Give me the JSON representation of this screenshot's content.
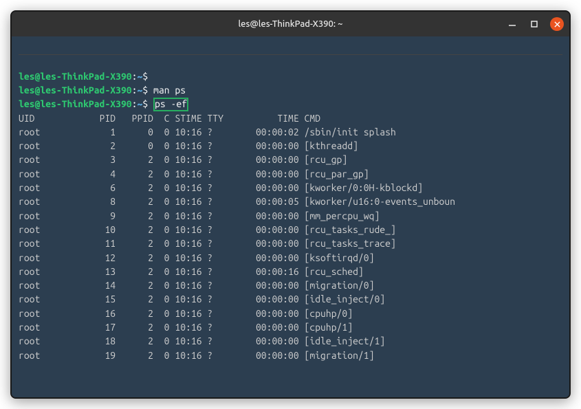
{
  "window": {
    "title": "les@les-ThinkPad-X390: ~"
  },
  "prompt": {
    "user_host": "les@les-ThinkPad-X390",
    "sep": ":",
    "path": "~",
    "dollar": "$"
  },
  "commands": {
    "empty": "",
    "manps": "man ps",
    "psef": "ps -ef"
  },
  "ps": {
    "header": {
      "uid": "UID",
      "pid": "PID",
      "ppid": "PPID",
      "c": "C",
      "stime": "STIME",
      "tty": "TTY",
      "time": "TIME",
      "cmd": "CMD"
    },
    "rows": [
      {
        "uid": "root",
        "pid": "1",
        "ppid": "0",
        "c": "0",
        "stime": "10:16",
        "tty": "?",
        "time": "00:00:02",
        "cmd": "/sbin/init splash"
      },
      {
        "uid": "root",
        "pid": "2",
        "ppid": "0",
        "c": "0",
        "stime": "10:16",
        "tty": "?",
        "time": "00:00:00",
        "cmd": "[kthreadd]"
      },
      {
        "uid": "root",
        "pid": "3",
        "ppid": "2",
        "c": "0",
        "stime": "10:16",
        "tty": "?",
        "time": "00:00:00",
        "cmd": "[rcu_gp]"
      },
      {
        "uid": "root",
        "pid": "4",
        "ppid": "2",
        "c": "0",
        "stime": "10:16",
        "tty": "?",
        "time": "00:00:00",
        "cmd": "[rcu_par_gp]"
      },
      {
        "uid": "root",
        "pid": "6",
        "ppid": "2",
        "c": "0",
        "stime": "10:16",
        "tty": "?",
        "time": "00:00:00",
        "cmd": "[kworker/0:0H-kblockd]"
      },
      {
        "uid": "root",
        "pid": "8",
        "ppid": "2",
        "c": "0",
        "stime": "10:16",
        "tty": "?",
        "time": "00:00:05",
        "cmd": "[kworker/u16:0-events_unboun"
      },
      {
        "uid": "root",
        "pid": "9",
        "ppid": "2",
        "c": "0",
        "stime": "10:16",
        "tty": "?",
        "time": "00:00:00",
        "cmd": "[mm_percpu_wq]"
      },
      {
        "uid": "root",
        "pid": "10",
        "ppid": "2",
        "c": "0",
        "stime": "10:16",
        "tty": "?",
        "time": "00:00:00",
        "cmd": "[rcu_tasks_rude_]"
      },
      {
        "uid": "root",
        "pid": "11",
        "ppid": "2",
        "c": "0",
        "stime": "10:16",
        "tty": "?",
        "time": "00:00:00",
        "cmd": "[rcu_tasks_trace]"
      },
      {
        "uid": "root",
        "pid": "12",
        "ppid": "2",
        "c": "0",
        "stime": "10:16",
        "tty": "?",
        "time": "00:00:00",
        "cmd": "[ksoftirqd/0]"
      },
      {
        "uid": "root",
        "pid": "13",
        "ppid": "2",
        "c": "0",
        "stime": "10:16",
        "tty": "?",
        "time": "00:00:16",
        "cmd": "[rcu_sched]"
      },
      {
        "uid": "root",
        "pid": "14",
        "ppid": "2",
        "c": "0",
        "stime": "10:16",
        "tty": "?",
        "time": "00:00:00",
        "cmd": "[migration/0]"
      },
      {
        "uid": "root",
        "pid": "15",
        "ppid": "2",
        "c": "0",
        "stime": "10:16",
        "tty": "?",
        "time": "00:00:00",
        "cmd": "[idle_inject/0]"
      },
      {
        "uid": "root",
        "pid": "16",
        "ppid": "2",
        "c": "0",
        "stime": "10:16",
        "tty": "?",
        "time": "00:00:00",
        "cmd": "[cpuhp/0]"
      },
      {
        "uid": "root",
        "pid": "17",
        "ppid": "2",
        "c": "0",
        "stime": "10:16",
        "tty": "?",
        "time": "00:00:00",
        "cmd": "[cpuhp/1]"
      },
      {
        "uid": "root",
        "pid": "18",
        "ppid": "2",
        "c": "0",
        "stime": "10:16",
        "tty": "?",
        "time": "00:00:00",
        "cmd": "[idle_inject/1]"
      },
      {
        "uid": "root",
        "pid": "19",
        "ppid": "2",
        "c": "0",
        "stime": "10:16",
        "tty": "?",
        "time": "00:00:00",
        "cmd": "[migration/1]"
      }
    ]
  }
}
